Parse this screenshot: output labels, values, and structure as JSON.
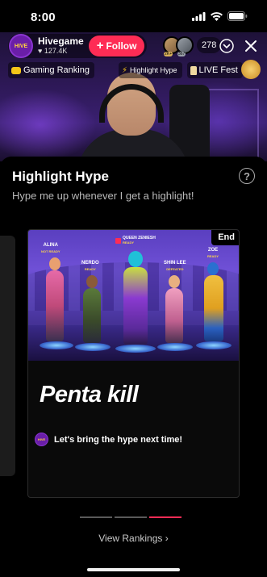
{
  "status_bar": {
    "time": "8:00"
  },
  "host": {
    "name": "Hivegame",
    "likes": "127.4K",
    "avatar_text": "HIVE",
    "follow_label": "Follow"
  },
  "viewers": {
    "count": "278",
    "avatar_badge_1": "2K+",
    "avatar_badge_2": "367"
  },
  "tags": [
    {
      "label": "Gaming Ranking",
      "icon": "gamepad-icon"
    },
    {
      "label": "Highlight Hype",
      "icon": "lightning-icon"
    },
    {
      "label": "LIVE Fest",
      "icon": "trophy-icon"
    }
  ],
  "panel": {
    "title": "Highlight Hype",
    "subtitle": "Hype me up whenever I get a highlight!",
    "help_icon": "?"
  },
  "card": {
    "end_label": "End",
    "crown_name": "QUEEN ZENIESH",
    "crown_status": "READY",
    "players": [
      {
        "name": "ALINA",
        "status": "NOT READY"
      },
      {
        "name": "NERDO",
        "status": "READY"
      },
      {
        "name": "SHIN LEE",
        "status": "DEFEATED"
      },
      {
        "name": "ZOE",
        "status": "READY"
      }
    ],
    "highlight": "Penta kill",
    "message_avatar": "HIVE",
    "message": "Let's bring the hype next time!"
  },
  "pager": {
    "total": 3,
    "active_index": 2
  },
  "link": {
    "label": "View Rankings ›"
  },
  "colors": {
    "accent": "#fe2c55",
    "panel_bg": "#000000",
    "stream_purple": "#3a2070"
  }
}
